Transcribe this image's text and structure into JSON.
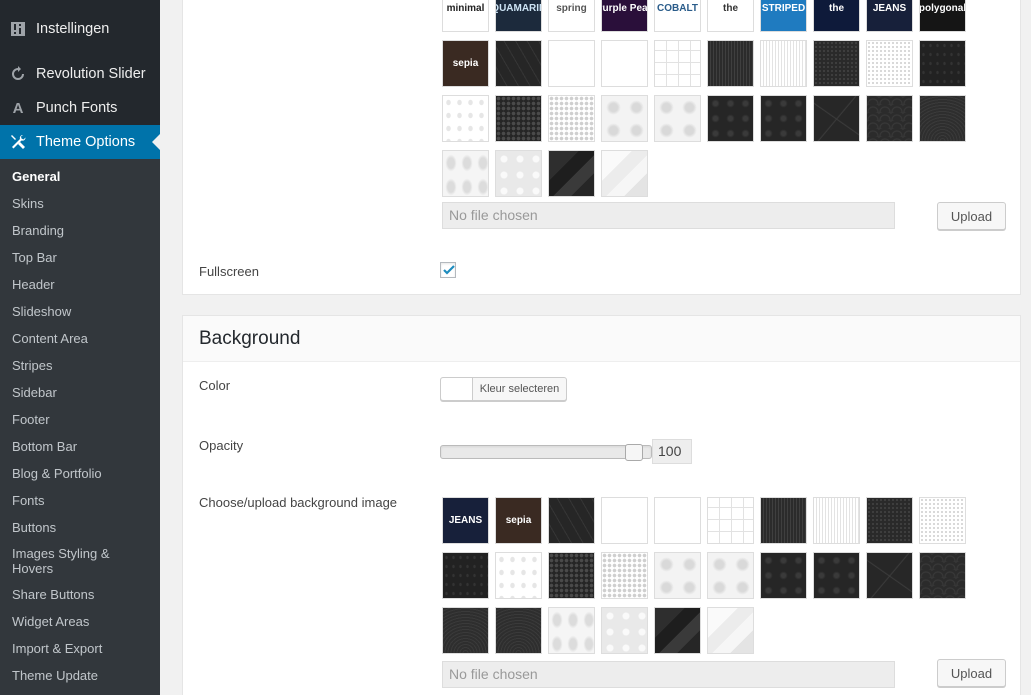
{
  "sidebar": {
    "top_items": [
      {
        "label": "Instellingen",
        "icon": "settings-sliders-icon"
      },
      {
        "label": "Revolution Slider",
        "icon": "refresh-icon"
      },
      {
        "label": "Punch Fonts",
        "icon": "font-a-icon"
      },
      {
        "label": "Theme Options",
        "icon": "tools-icon"
      }
    ],
    "active_top": "Theme Options",
    "submenu": [
      {
        "label": "General",
        "active": true
      },
      {
        "label": "Skins"
      },
      {
        "label": "Branding"
      },
      {
        "label": "Top Bar"
      },
      {
        "label": "Header"
      },
      {
        "label": "Slideshow"
      },
      {
        "label": "Content Area"
      },
      {
        "label": "Stripes"
      },
      {
        "label": "Sidebar"
      },
      {
        "label": "Footer"
      },
      {
        "label": "Bottom Bar"
      },
      {
        "label": "Blog & Portfolio"
      },
      {
        "label": "Fonts"
      },
      {
        "label": "Buttons"
      },
      {
        "label": "Images Styling & Hovers"
      },
      {
        "label": "Share Buttons"
      },
      {
        "label": "Widget Areas"
      },
      {
        "label": "Import & Export"
      },
      {
        "label": "Theme Update"
      }
    ]
  },
  "section1": {
    "skins": [
      {
        "label": "minimal",
        "bg": "#ffffff",
        "fg": "#222222"
      },
      {
        "label": "AQUAMARINE",
        "bg": "#1c2a3c",
        "fg": "#cde4f5"
      },
      {
        "label": "spring",
        "bg": "#ffffff",
        "fg": "#555555"
      },
      {
        "label": "Purple Peak",
        "bg": "#2a0f3a",
        "fg": "#ffffff"
      },
      {
        "label": "COBALT",
        "bg": "#ffffff",
        "fg": "#2a5c8a"
      },
      {
        "label": "the",
        "bg": "#ffffff",
        "fg": "#333333"
      },
      {
        "label": "STRIPED",
        "bg": "#1f7bc0",
        "fg": "#ffffff"
      },
      {
        "label": "the",
        "bg": "#0e1a3a",
        "fg": "#ffffff"
      },
      {
        "label": "JEANS",
        "bg": "#17203a",
        "fg": "#ffffff"
      },
      {
        "label": "polygonal",
        "bg": "#151515",
        "fg": "#ffffff"
      },
      {
        "label": "sepia",
        "bg": "#3a2a22",
        "fg": "#ffffff"
      }
    ],
    "textures": [
      "t-darkhex",
      "t-lighthex",
      "t-darkgrid",
      "t-lightgrid",
      "t-darkstripe",
      "t-lightstripe",
      "t-darkdots",
      "t-lightdots",
      "t-darkspeck",
      "t-lightspeck",
      "t-halftone-d",
      "t-halftone-l",
      "t-damask-l",
      "t-damask-l",
      "t-damask-d",
      "t-damask-d",
      "t-cracks",
      "t-waves",
      "t-fan",
      "t-ornament",
      "t-flower",
      "t-poly-d",
      "t-poly-l"
    ],
    "file_placeholder": "No file chosen",
    "upload_label": "Upload",
    "fullscreen_label": "Fullscreen",
    "fullscreen_checked": true
  },
  "section2": {
    "title": "Background",
    "color_label": "Color",
    "color_button": "Kleur selecteren",
    "color_value": "#ffffff",
    "opacity_label": "Opacity",
    "opacity_value": "100",
    "opacity_fraction": 0.96,
    "image_label": "Choose/upload background image",
    "images": [
      {
        "label": "JEANS",
        "bg": "#17203a",
        "fg": "#ffffff"
      },
      {
        "label": "sepia",
        "bg": "#3a2a22",
        "fg": "#ffffff"
      },
      "t-darkhex",
      "t-lighthex",
      "t-darkgrid",
      "t-lightgrid",
      "t-darkstripe",
      "t-lightstripe",
      "t-darkdots",
      "t-lightdots",
      "t-darkspeck",
      "t-lightspeck",
      "t-halftone-d",
      "t-halftone-l",
      "t-damask-l",
      "t-damask-l",
      "t-damask-d",
      "t-damask-d",
      "t-cracks",
      "t-waves",
      "t-fan",
      "t-fan",
      "t-ornament",
      "t-flower",
      "t-poly-d",
      "t-poly-l"
    ],
    "file_placeholder": "No file chosen",
    "upload_label": "Upload"
  }
}
